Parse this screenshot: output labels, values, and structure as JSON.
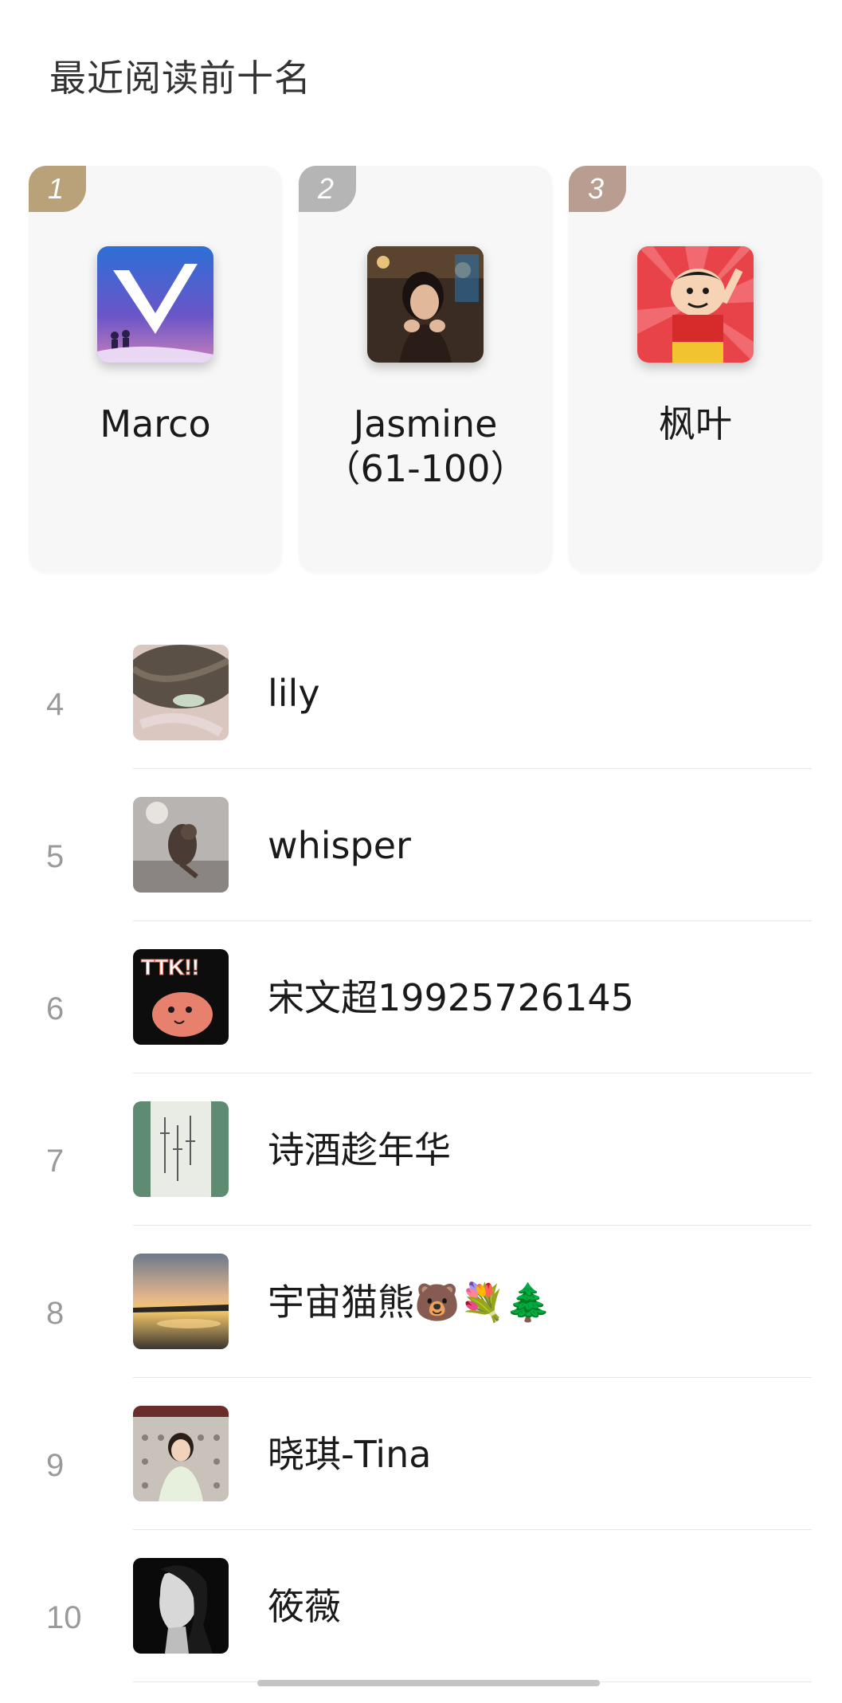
{
  "page": {
    "title": "最近阅读前十名"
  },
  "podium": [
    {
      "rank": "1",
      "name": "Marco",
      "badge_color": "#b9a27a",
      "avatar": "v-logo-avatar"
    },
    {
      "rank": "2",
      "name": "Jasmine（61-100）",
      "badge_color": "#b5b5b5",
      "avatar": "photo-avatar"
    },
    {
      "rank": "3",
      "name": "枫叶",
      "badge_color": "#b89d90",
      "avatar": "cartoon-avatar"
    }
  ],
  "list": [
    {
      "rank": "4",
      "name": "lily"
    },
    {
      "rank": "5",
      "name": "whisper"
    },
    {
      "rank": "6",
      "name": "宋文超19925726145"
    },
    {
      "rank": "7",
      "name": "诗酒趁年华"
    },
    {
      "rank": "8",
      "name": "宇宙猫熊🐻💐🌲"
    },
    {
      "rank": "9",
      "name": "晓琪-Tina"
    },
    {
      "rank": "10",
      "name": "筱薇"
    }
  ],
  "colors": {
    "text_primary": "#1a1a1a",
    "text_rank": "#9a9a9a",
    "card_bg": "#f7f7f7",
    "divider": "#e8e8e8"
  }
}
